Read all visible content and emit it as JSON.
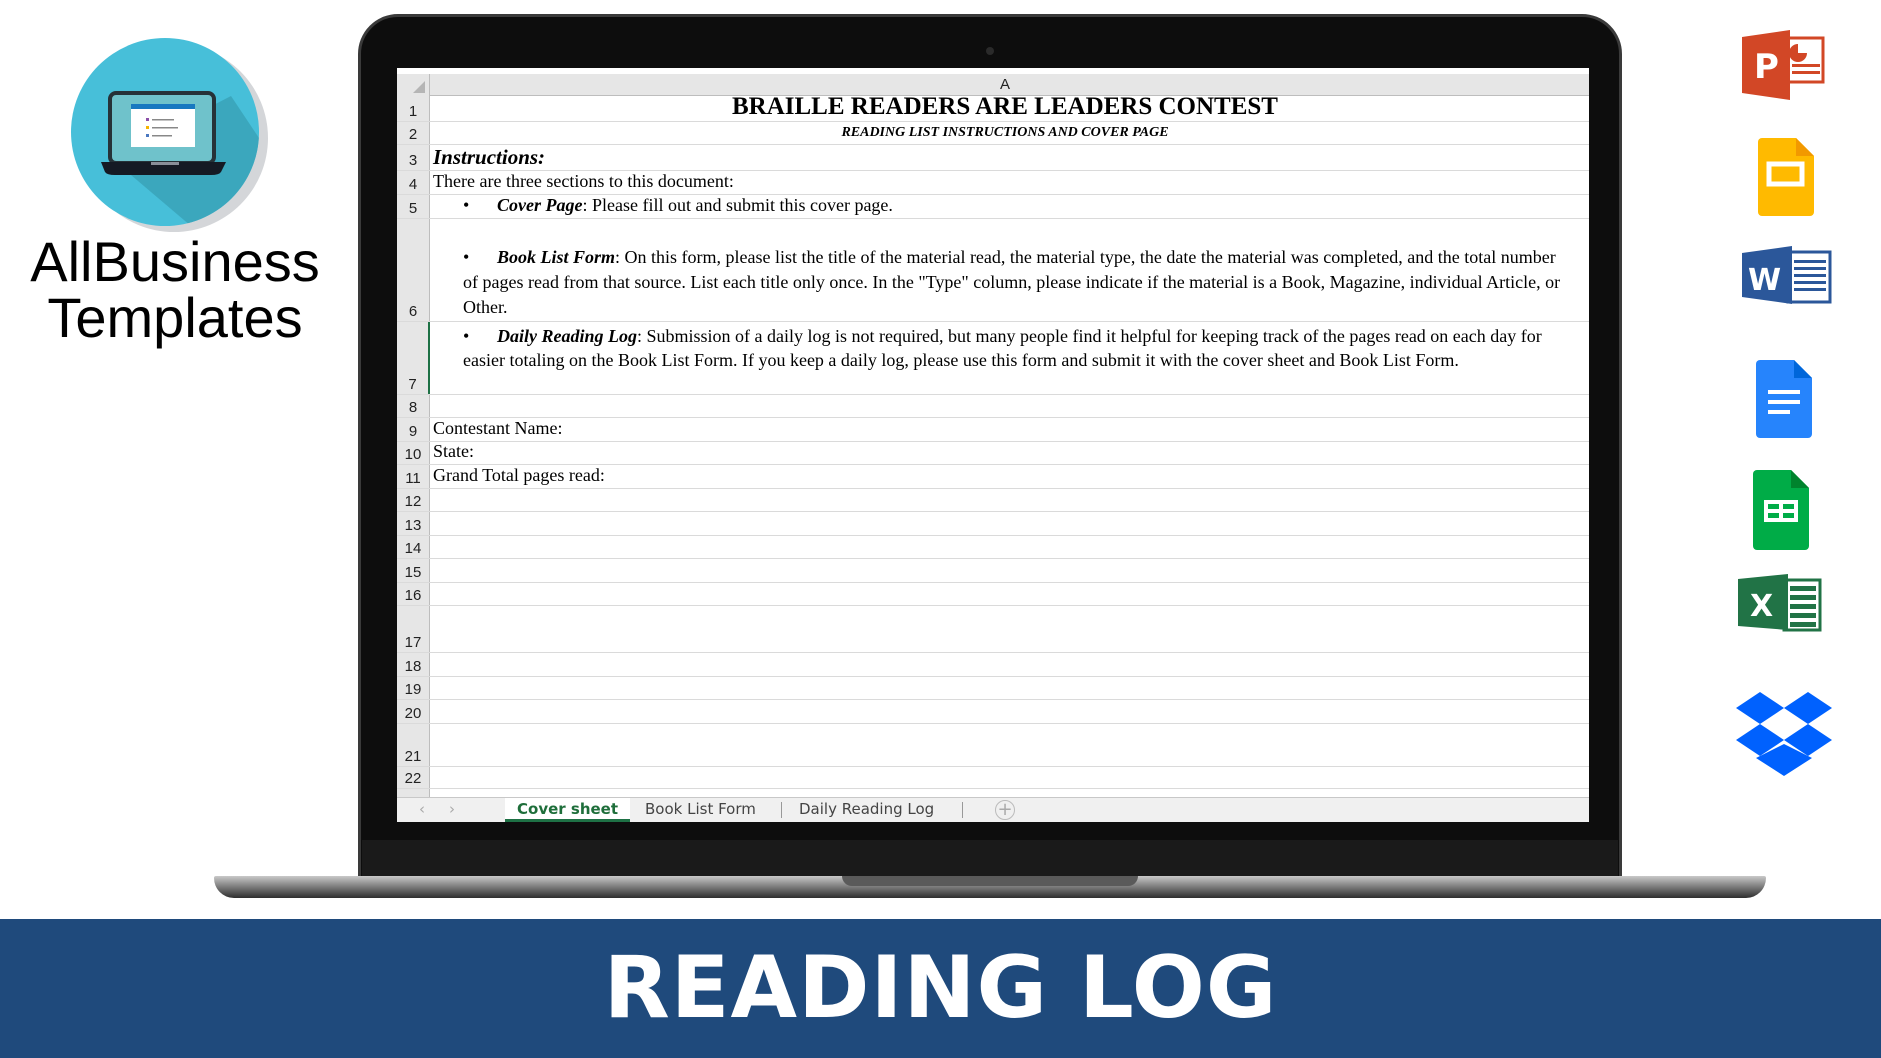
{
  "brand": {
    "line1": "AllBusiness",
    "line2": "Templates",
    "circle_color": "#47bfd9"
  },
  "banner": {
    "title": "READING LOG",
    "color": "#1f4a7c"
  },
  "sheet": {
    "column_header": "A",
    "rows": [
      {
        "n": "1",
        "text": "BRAILLE READERS ARE LEADERS CONTEST"
      },
      {
        "n": "2",
        "text": "READING LIST INSTRUCTIONS AND COVER PAGE"
      },
      {
        "n": "3",
        "text": "Instructions:"
      },
      {
        "n": "4",
        "text": "There are three sections to this document:"
      },
      {
        "n": "5",
        "label": "Cover Page",
        "text": ": Please fill out and submit this cover page."
      },
      {
        "n": "6",
        "label": "Book List Form",
        "text": ":  On this form, please list the title of the material read, the material type, the date the material was completed, and the total number of pages read from that source. List each title only once.   In the \"Type\" column, please indicate if the material is a Book, Magazine, individual Article, or Other."
      },
      {
        "n": "7",
        "label": "Daily Reading Log",
        "text": ": Submission of a daily log is not required, but many people find it helpful for keeping track of the pages read on each day for easier totaling on the Book List Form.  If you keep a daily log, please use this form and submit it with the cover sheet and Book List Form."
      },
      {
        "n": "8",
        "text": ""
      },
      {
        "n": "9",
        "text": "Contestant Name:"
      },
      {
        "n": "10",
        "text": "State:"
      },
      {
        "n": "11",
        "text": "Grand Total pages read:"
      },
      {
        "n": "12"
      },
      {
        "n": "13"
      },
      {
        "n": "14"
      },
      {
        "n": "15"
      },
      {
        "n": "16"
      },
      {
        "n": "17"
      },
      {
        "n": "18"
      },
      {
        "n": "19"
      },
      {
        "n": "20"
      },
      {
        "n": "21"
      },
      {
        "n": "22"
      }
    ],
    "bullet": "•",
    "tabs": [
      {
        "label": "Cover sheet",
        "active": true
      },
      {
        "label": "Book List Form"
      },
      {
        "label": "Daily Reading Log"
      }
    ],
    "add_sheet": "+",
    "nav_prev": "‹",
    "nav_next": "›",
    "accent": "#1e7145"
  },
  "app_icons": [
    "powerpoint-icon",
    "google-slides-icon",
    "word-icon",
    "google-docs-icon",
    "google-sheets-icon",
    "excel-icon",
    "dropbox-icon"
  ]
}
